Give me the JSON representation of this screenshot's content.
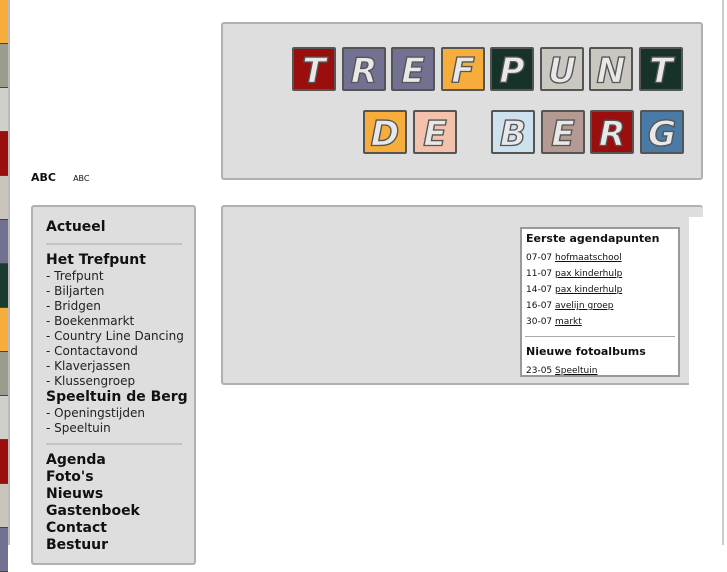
{
  "strip_colors": [
    "#f6ad3c",
    "#9a9c8c",
    "#cfd0cc",
    "#9b0e0e",
    "#c9c5bd",
    "#727192",
    "#1b3a30",
    "#f6ad3c",
    "#9a9c8c",
    "#cfd0cc",
    "#9b0e0e",
    "#c9c5bd",
    "#727192"
  ],
  "logo": {
    "row1": [
      {
        "l": "T",
        "c": "#9b0e0e"
      },
      {
        "l": "R",
        "c": "#727192"
      },
      {
        "l": "E",
        "c": "#727192"
      },
      {
        "l": "F",
        "c": "#f6ad3c"
      },
      {
        "l": "P",
        "c": "#163229"
      },
      {
        "l": "U",
        "c": "#c9c7bf"
      },
      {
        "l": "N",
        "c": "#c9c7bf"
      },
      {
        "l": "T",
        "c": "#163229"
      }
    ],
    "row2": [
      {
        "l": "D",
        "c": "#f6ad3c"
      },
      {
        "l": "E",
        "c": "#f3c2ad"
      },
      {
        "l": "B",
        "c": "#cde2ee"
      },
      {
        "l": "E",
        "c": "#b39a92"
      },
      {
        "l": "R",
        "c": "#9b0e0e"
      },
      {
        "l": "G",
        "c": "#4a7aa6"
      }
    ]
  },
  "font_size": {
    "large": "ABC",
    "small": "ABC"
  },
  "menu": {
    "actueel": "Actueel",
    "trefpunt": "Het Trefpunt",
    "trefpunt_items": [
      "- Trefpunt",
      "- Biljarten",
      "- Bridgen",
      "- Boekenmarkt",
      "- Country Line Dancing",
      "- Contactavond",
      "- Klaverjassen",
      "- Klussengroep"
    ],
    "speeltuin": "Speeltuin de Berg",
    "speeltuin_items": [
      "- Openingstijden",
      "- Speeltuin"
    ],
    "main": [
      "Agenda",
      "Foto's",
      "Nieuws",
      "Gastenboek",
      "Contact",
      "Bestuur"
    ]
  },
  "agenda": {
    "title": "Eerste agendapunten",
    "items": [
      {
        "date": "07-07",
        "label": "hofmaatschool"
      },
      {
        "date": "11-07",
        "label": "pax kinderhulp"
      },
      {
        "date": "14-07",
        "label": "pax kinderhulp"
      },
      {
        "date": "16-07",
        "label": "avelijn groep"
      },
      {
        "date": "30-07",
        "label": "markt"
      }
    ],
    "albums_title": "Nieuwe fotoalbums",
    "albums": [
      {
        "date": "23-05",
        "label": "Speeltuin"
      }
    ]
  }
}
